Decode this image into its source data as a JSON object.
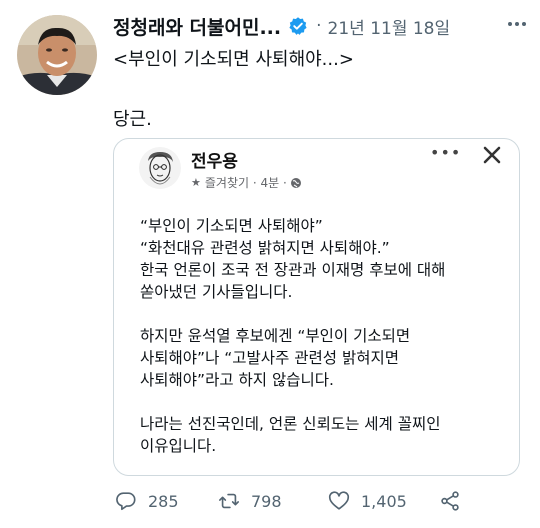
{
  "author": {
    "name": "정청래와 더불어민...",
    "date": "21년 11월 18일"
  },
  "tweet": {
    "line1": "<부인이 기소되면 사퇴해야...>",
    "line2": "당근."
  },
  "card": {
    "name": "전우용",
    "meta_favorite": "즐겨찾기",
    "meta_time": "4분",
    "body": [
      "“부인이 기소되면 사퇴해야”",
      "“화천대유 관련성 밝혀지면 사퇴해야.”",
      "한국 언론이 조국 전 장관과 이재명 후보에 대해",
      "쏟아냈던 기사들입니다.",
      "",
      "하지만 윤석열 후보에겐 “부인이 기소되면",
      "사퇴해야”나 “고발사주 관련성 밝혀지면",
      "사퇴해야”라고 하지 않습니다.",
      "",
      "나라는 선진국인데, 언론 신뢰도는 세계 꼴찌인",
      "이유입니다."
    ]
  },
  "actions": {
    "replies": "285",
    "retweets": "798",
    "likes": "1,405"
  },
  "colors": {
    "verified": "#1d9bf0",
    "secondary": "#536471",
    "border": "#cfd9de"
  }
}
